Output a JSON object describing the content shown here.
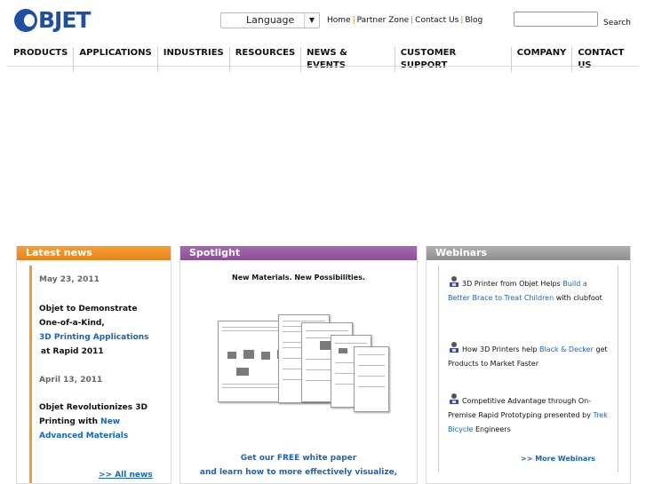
{
  "logo": {
    "text": "BJET"
  },
  "header": {
    "language_label": "Language",
    "links": [
      "Home",
      "Partner Zone",
      "Contact Us",
      "Blog"
    ],
    "search_label": "Search",
    "search_value": ""
  },
  "nav": [
    "PRODUCTS",
    "APPLICATIONS",
    "INDUSTRIES",
    "RESOURCES",
    "NEWS & EVENTS",
    "CUSTOMER SUPPORT",
    "COMPANY",
    "CONTACT US"
  ],
  "latest": {
    "title": "Latest news",
    "item1": {
      "date": "May 23, 2011",
      "line1": "Objet to Demonstrate",
      "line2": "One-of-a-Kind,",
      "link": "3D Printing Applications",
      "line3": "at Rapid 2011"
    },
    "item2": {
      "date": "April 13, 2011",
      "line1": "Objet Revolutionizes 3D",
      "line2": "Printing with",
      "link1": "New",
      "link2": "Advanced Materials"
    },
    "all_news": ">> All news"
  },
  "spotlight": {
    "title": "Spotlight",
    "heading": "New Materials. New Possibilities.",
    "cta1": "Get our FREE white paper",
    "cta2": "and learn how to more effectively visualize,"
  },
  "webinars": {
    "title": "Webinars",
    "item1": {
      "pre": "3D Printer from Objet Helps",
      "link": "Build a Better Brace to Treat Children",
      "post": "with clubfoot"
    },
    "item2": {
      "pre": "How 3D Printers help",
      "link": "Black & Decker",
      "post": "get Products to Market Faster"
    },
    "item3": {
      "pre": "Competitive Advantage through On-Premise Rapid Prototyping presented by",
      "link": "Trek Bicycle",
      "post": "Engineers"
    },
    "more": ">> More Webinars"
  }
}
